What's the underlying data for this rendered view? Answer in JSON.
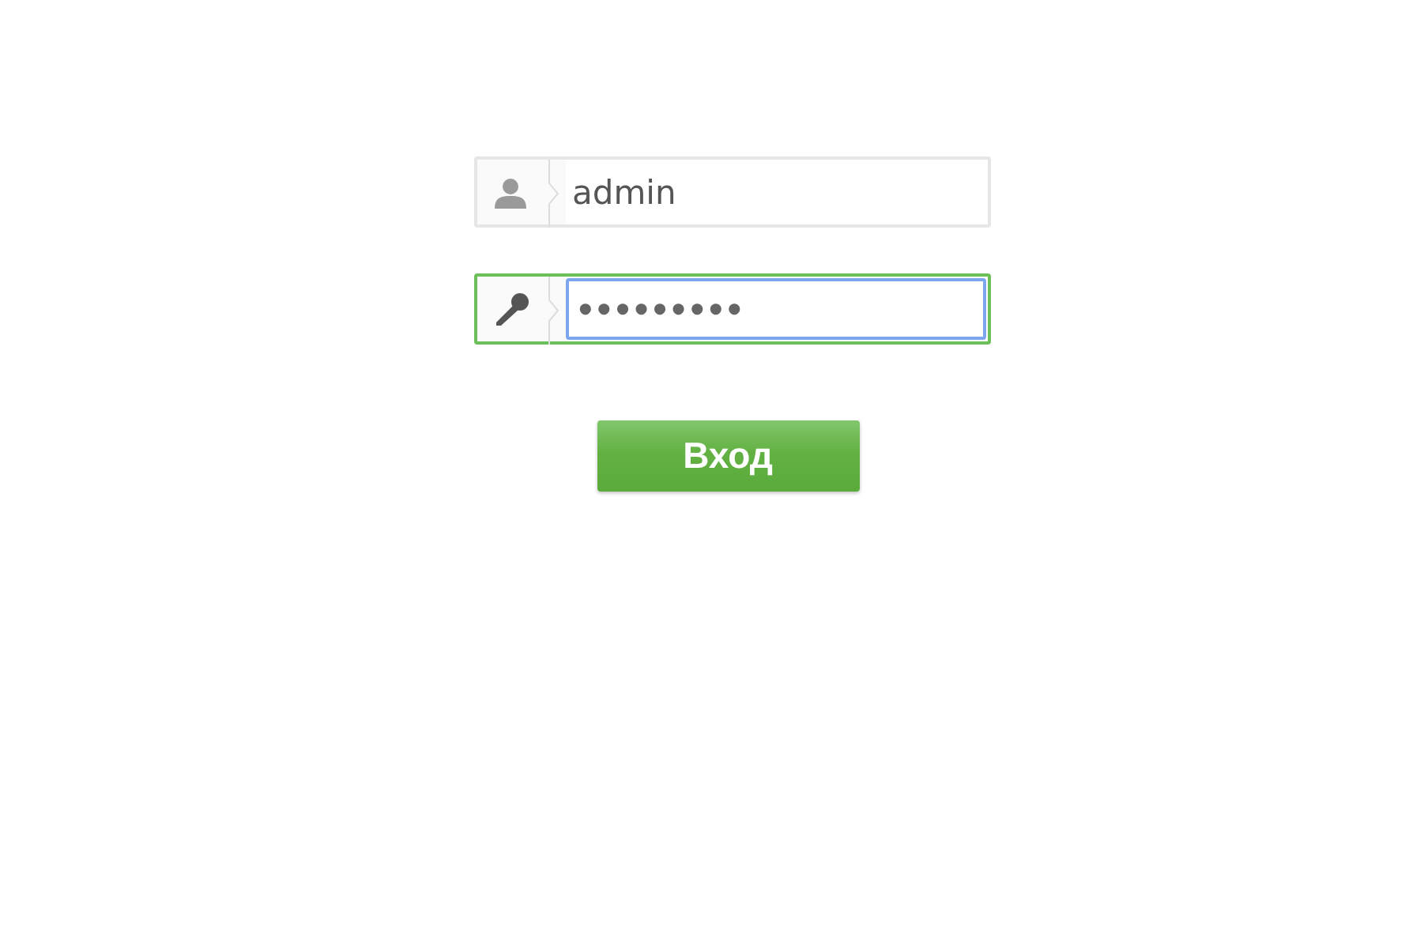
{
  "login_form": {
    "fields": [
      {
        "kind": "username",
        "value": "admin",
        "focused": false
      },
      {
        "kind": "password",
        "value": "•••••••••",
        "focused": true
      }
    ],
    "submit_button": "Вход"
  }
}
